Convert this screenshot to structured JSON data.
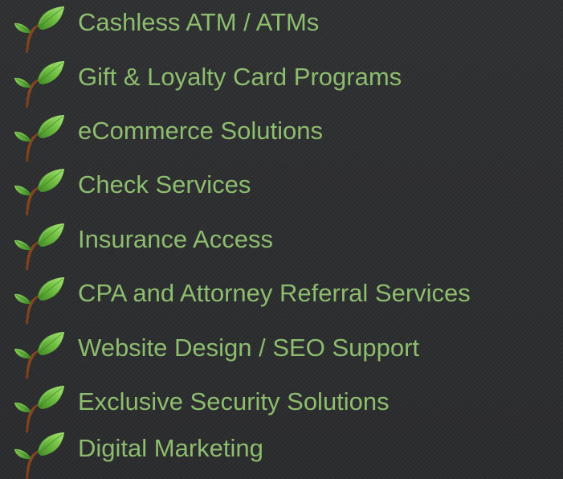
{
  "services": {
    "items": [
      {
        "label": "Cashless ATM / ATMs",
        "icon": "leaf-sprout-icon"
      },
      {
        "label": "Gift & Loyalty Card Programs",
        "icon": "leaf-sprout-icon"
      },
      {
        "label": "eCommerce Solutions",
        "icon": "leaf-sprout-icon"
      },
      {
        "label": "Check Services",
        "icon": "leaf-sprout-icon"
      },
      {
        "label": "Insurance Access",
        "icon": "leaf-sprout-icon"
      },
      {
        "label": "CPA and Attorney Referral Services",
        "icon": "leaf-sprout-icon"
      },
      {
        "label": "Website Design / SEO Support",
        "icon": "leaf-sprout-icon"
      },
      {
        "label": "Exclusive Security Solutions",
        "icon": "leaf-sprout-icon"
      },
      {
        "label": "Digital Marketing",
        "icon": "leaf-sprout-icon"
      }
    ]
  },
  "colors": {
    "background": "#2c2d2f",
    "label_text": "#8dbd6e",
    "leaf_light": "#9fe26a",
    "leaf_dark": "#3f8a26",
    "stem": "#7a3d1c"
  }
}
